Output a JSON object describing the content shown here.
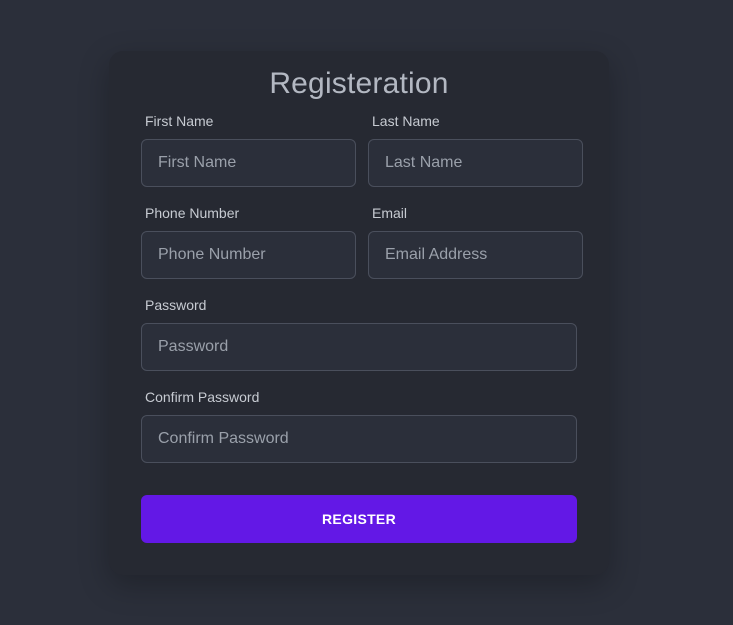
{
  "form": {
    "title": "Registeration",
    "first_name": {
      "label": "First Name",
      "placeholder": "First Name"
    },
    "last_name": {
      "label": "Last Name",
      "placeholder": "Last Name"
    },
    "phone": {
      "label": "Phone Number",
      "placeholder": "Phone Number"
    },
    "email": {
      "label": "Email",
      "placeholder": "Email Address"
    },
    "password": {
      "label": "Password",
      "placeholder": "Password"
    },
    "confirm_password": {
      "label": "Confirm Password",
      "placeholder": "Confirm Password"
    },
    "submit_label": "REGISTER"
  },
  "colors": {
    "page_background": "#2b2f3a",
    "card_background": "#262932",
    "accent": "#6318e6"
  }
}
